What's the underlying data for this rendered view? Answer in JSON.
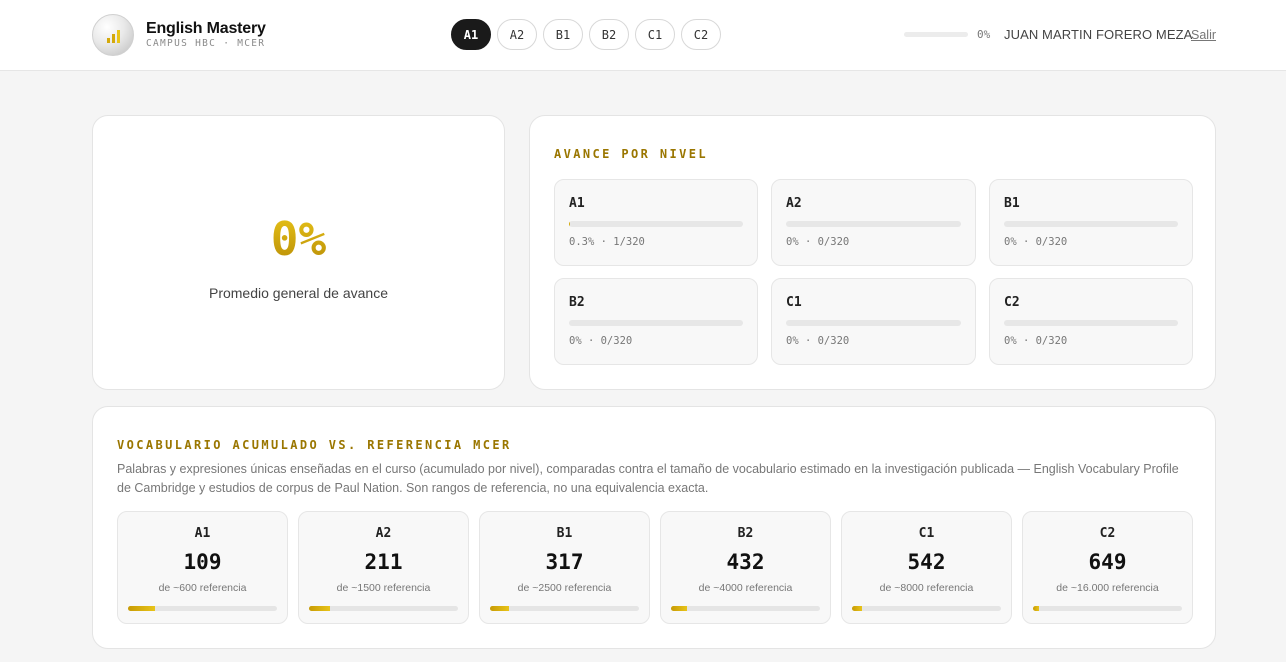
{
  "brand": {
    "title": "English Mastery",
    "subtitle": "CAMPUS HBC · MCER",
    "logo_icon": "bar-chart-icon"
  },
  "header": {
    "level_tabs": [
      {
        "label": "A1",
        "active": true
      },
      {
        "label": "A2",
        "active": false
      },
      {
        "label": "B1",
        "active": false
      },
      {
        "label": "B2",
        "active": false
      },
      {
        "label": "C1",
        "active": false
      },
      {
        "label": "C2",
        "active": false
      }
    ],
    "progress_value": 0,
    "progress_label": "0%",
    "user_name": "JUAN MARTIN FORERO MEZA",
    "logout_label": "Salir"
  },
  "average": {
    "value": "0%",
    "label": "Promedio general de avance"
  },
  "levels_progress": {
    "title": "AVANCE POR NIVEL",
    "items": [
      {
        "name": "A1",
        "fraction": 0.003,
        "stat": "0.3% · 1/320"
      },
      {
        "name": "A2",
        "fraction": 0,
        "stat": "0% · 0/320"
      },
      {
        "name": "B1",
        "fraction": 0,
        "stat": "0% · 0/320"
      },
      {
        "name": "B2",
        "fraction": 0,
        "stat": "0% · 0/320"
      },
      {
        "name": "C1",
        "fraction": 0,
        "stat": "0% · 0/320"
      },
      {
        "name": "C2",
        "fraction": 0,
        "stat": "0% · 0/320"
      }
    ]
  },
  "vocabulary": {
    "title": "VOCABULARIO ACUMULADO VS. REFERENCIA MCER",
    "description": "Palabras y expresiones únicas enseñadas en el curso (acumulado por nivel), comparadas contra el tamaño de vocabulario estimado en la investigación publicada — English Vocabulary Profile de Cambridge y estudios de corpus de Paul Nation. Son rangos de referencia, no una equivalencia exacta.",
    "items": [
      {
        "name": "A1",
        "count": "109",
        "reference": "de ~600 referencia",
        "fraction": 0.18
      },
      {
        "name": "A2",
        "count": "211",
        "reference": "de ~1500 referencia",
        "fraction": 0.14
      },
      {
        "name": "B1",
        "count": "317",
        "reference": "de ~2500 referencia",
        "fraction": 0.13
      },
      {
        "name": "B2",
        "count": "432",
        "reference": "de ~4000 referencia",
        "fraction": 0.11
      },
      {
        "name": "C1",
        "count": "542",
        "reference": "de ~8000 referencia",
        "fraction": 0.07
      },
      {
        "name": "C2",
        "count": "649",
        "reference": "de ~16.000 referencia",
        "fraction": 0.04
      }
    ]
  },
  "colors": {
    "accent": "#d4a90b",
    "section_title": "#9a7600",
    "active_tab": "#1a1a1a"
  }
}
